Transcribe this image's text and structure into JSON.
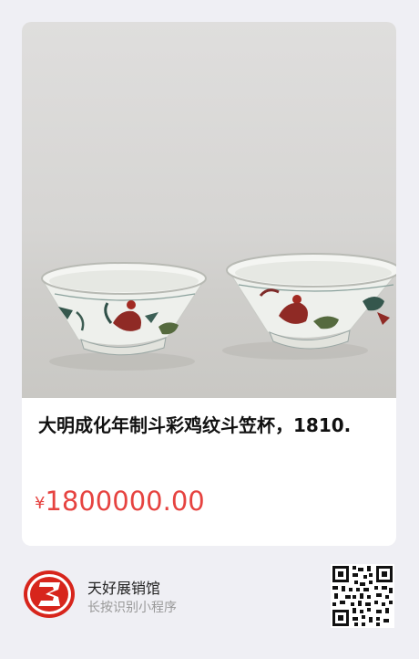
{
  "product": {
    "image_alt": "两只斗彩鸡纹斗笠杯",
    "title": "大明成化年制斗彩鸡纹斗笠杯，1810.",
    "currency": "¥",
    "price": "1800000.00"
  },
  "footer": {
    "shop_name": "天好展销馆",
    "hint": "长按识别小程序"
  },
  "colors": {
    "price": "#e64340",
    "page_bg": "#efeff4",
    "logo_red": "#d7251c"
  },
  "icons": {
    "logo": "shop-logo-icon",
    "qr": "qr-code-icon"
  }
}
